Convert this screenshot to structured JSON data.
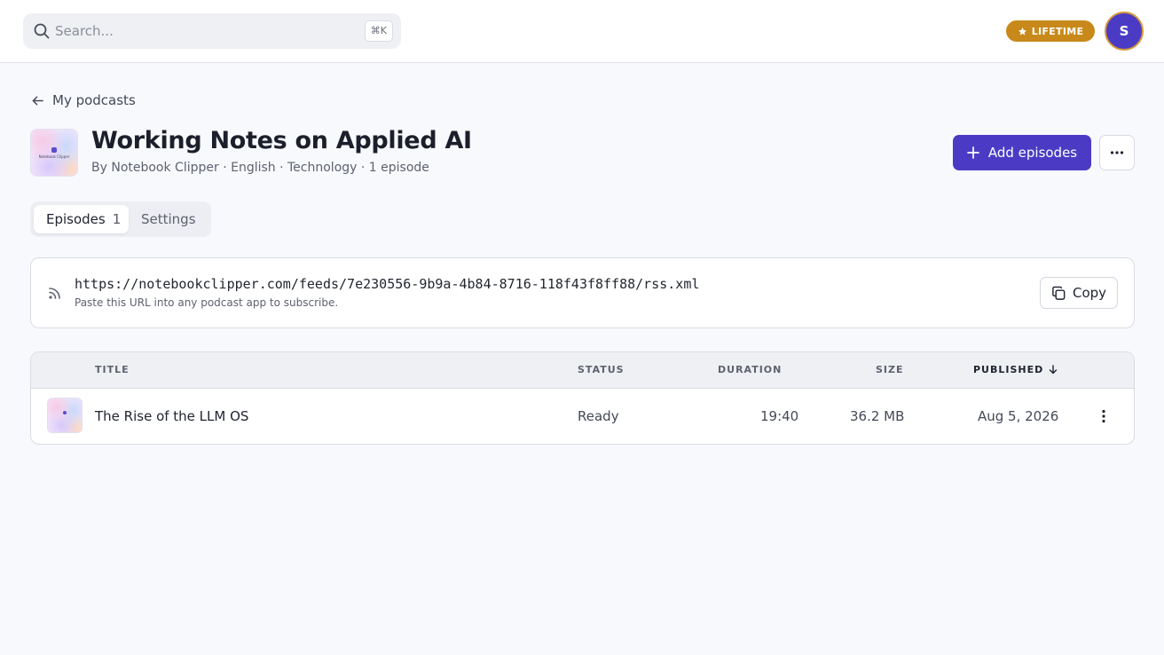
{
  "topbar": {
    "search_placeholder": "Search...",
    "search_shortcut": "⌘K",
    "badge_label": "LIFETIME",
    "avatar_initial": "S"
  },
  "nav": {
    "back_label": "My podcasts"
  },
  "podcast": {
    "title": "Working Notes on Applied AI",
    "meta": "By Notebook Clipper · English · Technology · 1 episode",
    "cover_text": "Notebook Clipper",
    "add_button_label": "Add episodes"
  },
  "tabs": [
    {
      "label": "Episodes",
      "count": "1",
      "active": true
    },
    {
      "label": "Settings",
      "active": false
    }
  ],
  "rss": {
    "url": "https://notebookclipper.com/feeds/7e230556-9b9a-4b84-8716-118f43f8ff88/rss.xml",
    "hint": "Paste this URL into any podcast app to subscribe.",
    "copy_label": "Copy"
  },
  "table": {
    "headers": {
      "title": "TITLE",
      "status": "STATUS",
      "duration": "DURATION",
      "size": "SIZE",
      "published": "PUBLISHED"
    },
    "rows": [
      {
        "title": "The Rise of the LLM OS",
        "status": "Ready",
        "duration": "19:40",
        "size": "36.2 MB",
        "published": "Aug 5, 2026"
      }
    ]
  },
  "colors": {
    "accent": "#4b3bc4",
    "badge": "#c8891a",
    "background": "#f8f9fd"
  }
}
